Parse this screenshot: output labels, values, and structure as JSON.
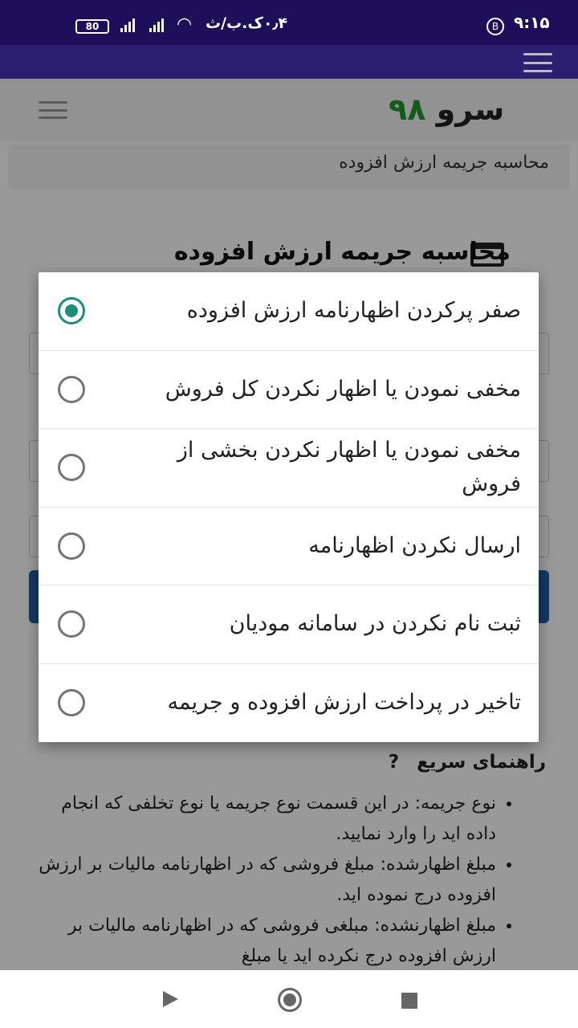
{
  "status_bar": {
    "time": "۹:۱۵",
    "b_icon": "B",
    "carrier": "۰٫۴ک.ب/ث",
    "battery": "80"
  },
  "header": {
    "logo_text": "سرو",
    "logo_number": "۹۸"
  },
  "breadcrumb": "محاسبه جریمه ارزش افزوده",
  "page_title": "محاسبه جریمه ارزش افزوده",
  "dialog": {
    "options": [
      {
        "label": "صفر پرکردن اظهارنامه ارزش افزوده",
        "selected": true
      },
      {
        "label": "مخفی نمودن یا اظهار نکردن کل فروش",
        "selected": false
      },
      {
        "label": "مخفی نمودن یا اظهار نکردن بخشی از فروش",
        "selected": false
      },
      {
        "label": "ارسال نکردن اظهارنامه",
        "selected": false
      },
      {
        "label": "ثبت نام نکردن در سامانه مودیان",
        "selected": false
      },
      {
        "label": "تاخیر در پرداخت ارزش افزوده و جریمه",
        "selected": false
      }
    ]
  },
  "help": {
    "icon": "?",
    "title": "راهنمای سریع",
    "items": [
      "نوع جریمه: در این قسمت نوع جریمه یا نوع تخلفی که انجام داده اید را وارد نمایید.",
      "مبلغ اظهارشده: مبلغ فروشی که در اظهارنامه مالیات بر ارزش افزوده درج نموده اید.",
      "مبلغ اظهارنشده: مبلغی فروشی که در اظهارنامه مالیات بر ارزش افزوده درج نکرده اید یا مبلغ"
    ]
  },
  "colors": {
    "status_bar": "#1e0f5a",
    "app_bar": "#2c1e70",
    "accent_radio": "#1a8f7a",
    "logo_green": "#1f9a2a"
  }
}
